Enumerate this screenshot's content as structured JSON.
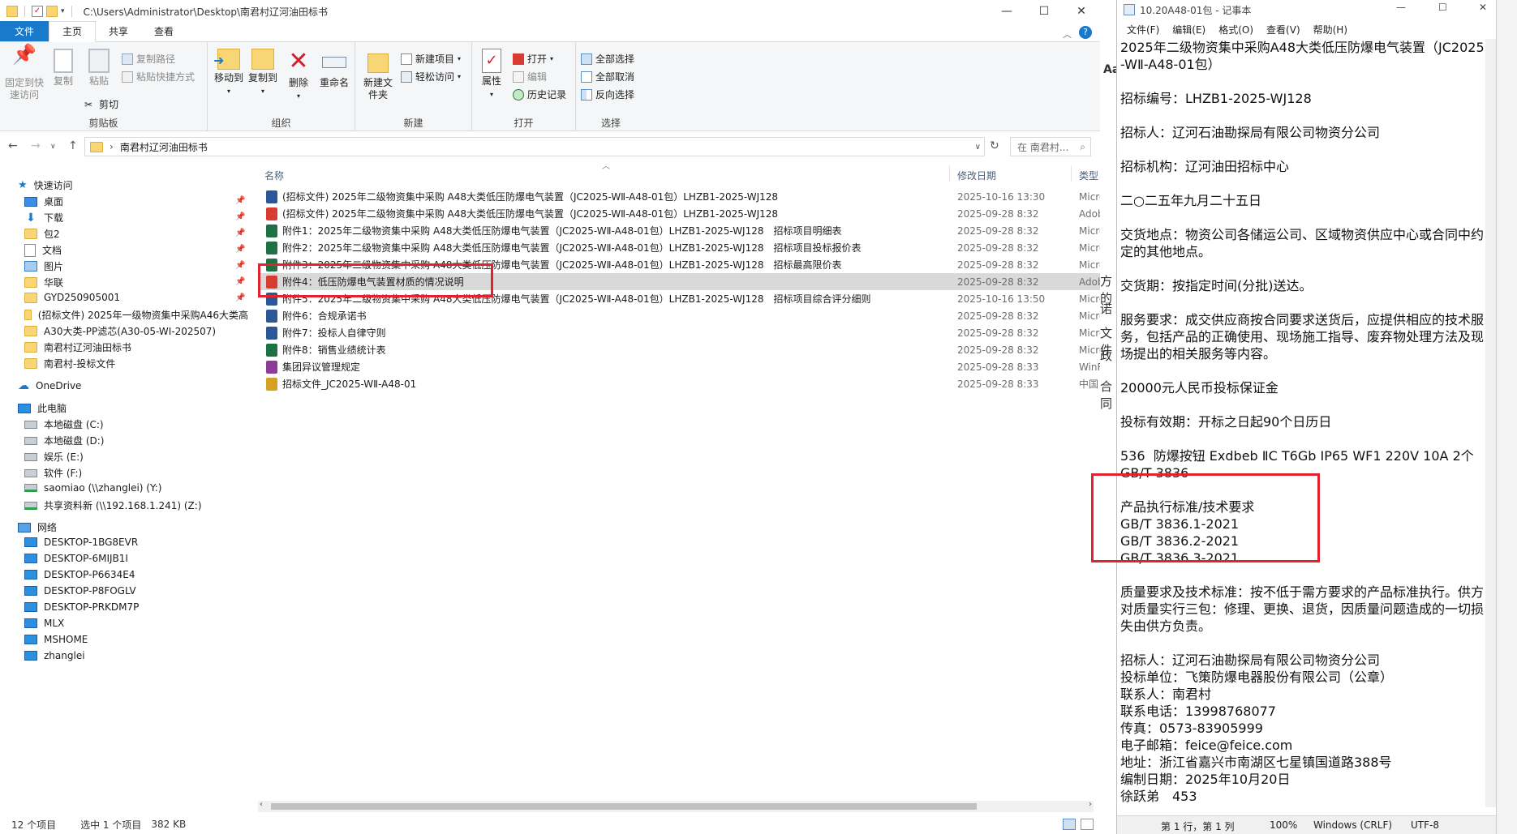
{
  "explorer": {
    "title": "C:\\Users\\Administrator\\Desktop\\南君村辽河油田标书",
    "tabs": [
      "文件",
      "主页",
      "共享",
      "查看"
    ],
    "ribbon": {
      "clipboard": {
        "pin": "固定到快速访问",
        "copy": "复制",
        "paste": "粘贴",
        "copy_path": "复制路径",
        "paste_shortcut": "粘贴快捷方式",
        "cut": "剪切",
        "label": "剪贴板"
      },
      "organize": {
        "move_to": "移动到",
        "copy_to": "复制到",
        "delete": "删除",
        "rename": "重命名",
        "label": "组织"
      },
      "new": {
        "new_folder": "新建文件夹",
        "new_item": "新建项目",
        "easy_access": "轻松访问",
        "label": "新建"
      },
      "open": {
        "properties": "属性",
        "open": "打开",
        "edit": "编辑",
        "history": "历史记录",
        "label": "打开"
      },
      "select": {
        "select_all": "全部选择",
        "select_none": "全部取消",
        "invert": "反向选择",
        "label": "选择"
      }
    },
    "address": {
      "path": "南君村辽河油田标书",
      "search_placeholder": "在 南君村..."
    },
    "nav": {
      "quick_access": "快速访问",
      "quick_items": [
        "桌面",
        "下载",
        "包2",
        "文档",
        "图片",
        "华联",
        "GYD250905001",
        "(招标文件) 2025年一级物资集中采购A46大类高",
        "A30大类-PP滤芯(A30-05-WI-202507)",
        "南君村辽河油田标书",
        "南君村-投标文件"
      ],
      "onedrive": "OneDrive",
      "this_pc": "此电脑",
      "drives": [
        "本地磁盘 (C:)",
        "本地磁盘 (D:)",
        "娱乐 (E:)",
        "软件 (F:)",
        "saomiao (\\\\zhanglei) (Y:)",
        "共享资料新 (\\\\192.168.1.241) (Z:)"
      ],
      "network": "网络",
      "network_items": [
        "DESKTOP-1BG8EVR",
        "DESKTOP-6MIJB1I",
        "DESKTOP-P6634E4",
        "DESKTOP-P8FOGLV",
        "DESKTOP-PRKDM7P",
        "MLX",
        "MSHOME",
        "zhanglei"
      ]
    },
    "columns": {
      "name": "名称",
      "date": "修改日期",
      "type": "类型"
    },
    "files": [
      {
        "name": "(招标文件) 2025年二级物资集中采购 A48大类低压防爆电气装置（JC2025-WⅡ-A48-01包）LHZB1-2025-WJ128",
        "date": "2025-10-16 13:30",
        "type": "Micro",
        "icon_color": "#2b5797"
      },
      {
        "name": "(招标文件) 2025年二级物资集中采购 A48大类低压防爆电气装置（JC2025-WⅡ-A48-01包）LHZB1-2025-WJ128",
        "date": "2025-09-28 8:32",
        "type": "Adobe",
        "icon_color": "#d83b30"
      },
      {
        "name": "附件1：2025年二级物资集中采购 A48大类低压防爆电气装置（JC2025-WⅡ-A48-01包）LHZB1-2025-WJ128　招标项目明细表",
        "date": "2025-09-28 8:32",
        "type": "Micro",
        "icon_color": "#1e7145"
      },
      {
        "name": "附件2：2025年二级物资集中采购 A48大类低压防爆电气装置（JC2025-WⅡ-A48-01包）LHZB1-2025-WJ128　招标项目投标报价表",
        "date": "2025-09-28 8:32",
        "type": "Micro",
        "icon_color": "#1e7145"
      },
      {
        "name": "附件3：2025年二级物资集中采购 A48大类低压防爆电气装置（JC2025-WⅡ-A48-01包）LHZB1-2025-WJ128　招标最高限价表",
        "date": "2025-09-28 8:32",
        "type": "Micro",
        "icon_color": "#1e7145"
      },
      {
        "name": "附件4：低压防爆电气装置材质的情况说明",
        "date": "2025-09-28 8:32",
        "type": "Adobe",
        "icon_color": "#d83b30",
        "selected": true
      },
      {
        "name": "附件5：2025年二级物资集中采购 A48大类低压防爆电气装置（JC2025-WⅡ-A48-01包）LHZB1-2025-WJ128　招标项目综合评分细则",
        "date": "2025-10-16 13:50",
        "type": "Micro",
        "icon_color": "#2b5797"
      },
      {
        "name": "附件6：合规承诺书",
        "date": "2025-09-28 8:32",
        "type": "Micro",
        "icon_color": "#2b5797"
      },
      {
        "name": "附件7：投标人自律守则",
        "date": "2025-09-28 8:32",
        "type": "Micro",
        "icon_color": "#2b5797"
      },
      {
        "name": "附件8：销售业绩统计表",
        "date": "2025-09-28 8:32",
        "type": "Micro",
        "icon_color": "#1e7145"
      },
      {
        "name": "集团异议管理规定",
        "date": "2025-09-28 8:33",
        "type": "WinR",
        "icon_color": "#8e3a9d"
      },
      {
        "name": "招标文件_JC2025-WⅡ-A48-01",
        "date": "2025-09-28 8:33",
        "type": "中国",
        "icon_color": "#d8a020"
      }
    ],
    "status": {
      "count": "12 个项目",
      "selected": "选中 1 个项目",
      "size": "382 KB"
    }
  },
  "notepad": {
    "title": "10.20A48-01包 - 记事本",
    "menu": [
      "文件(F)",
      "编辑(E)",
      "格式(O)",
      "查看(V)",
      "帮助(H)"
    ],
    "content": "2025年二级物资集中采购A48大类低压防爆电气装置（JC2025-WⅡ-A48-01包）\n\n招标编号：LHZB1-2025-WJ128\n\n招标人：辽河石油勘探局有限公司物资分公司\n\n招标机构：辽河油田招标中心\n\n二○二五年九月二十五日\n\n交货地点：物资公司各储运公司、区域物资供应中心或合同中约定的其他地点。\n\n交货期：按指定时间(分批)送达。\n\n服务要求：成交供应商按合同要求送货后，应提供相应的技术服务，包括产品的正确使用、现场施工指导、废弃物处理方法及现场提出的相关服务等内容。\n\n20000元人民币投标保证金\n\n投标有效期：开标之日起90个日历日\n\n536  防爆按钮 Exdbeb ⅡC T6Gb IP65 WF1 220V 10A 2个\nGB/T 3836\n\n产品执行标准/技术要求\nGB/T 3836.1-2021\nGB/T 3836.2-2021\nGB/T 3836.3-2021\n\n质量要求及技术标准：按不低于需方要求的产品标准执行。供方对质量实行三包：修理、更换、退货，因质量问题造成的一切损失由供方负责。\n\n招标人：辽河石油勘探局有限公司物资分公司\n投标单位：飞策防爆电器股份有限公司（公章）\n联系人：南君村\n联系电话：13998768077\n传真：0573-83905999\n电子邮箱：feice@feice.com\n地址：浙江省嘉兴市南湖区七星镇国道路388号\n编制日期：2025年10月20日\n徐跃弟　453",
    "status": {
      "position": "第 1 行，第 1 列",
      "zoom": "100%",
      "eol": "Windows (CRLF)",
      "encoding": "UTF-8"
    }
  },
  "background_fragments": [
    "Aa",
    "方的",
    "诺",
    "文件",
    "政",
    "合同"
  ]
}
